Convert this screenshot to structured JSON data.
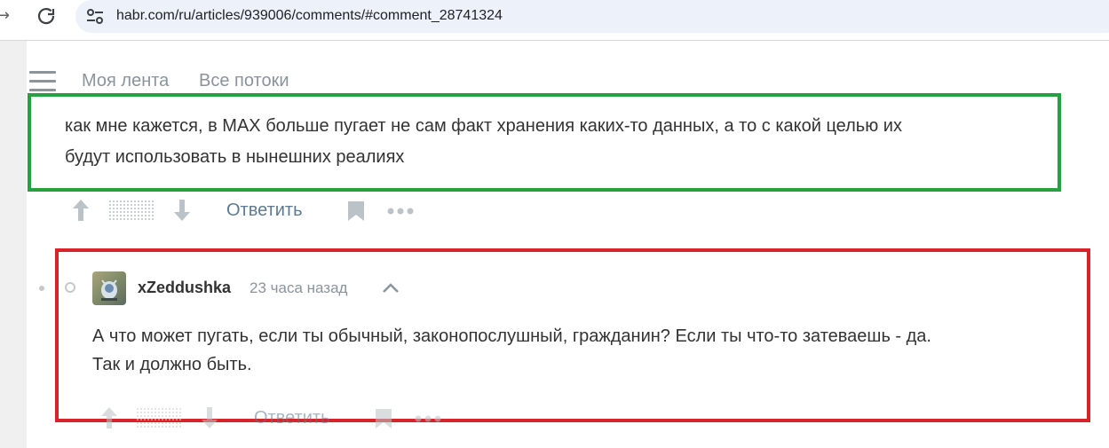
{
  "browser": {
    "url": "habr.com/ru/articles/939006/comments/#comment_28741324"
  },
  "header": {
    "nav": [
      "Моя лента",
      "Все потоки"
    ]
  },
  "comment_parent": {
    "lines": [
      "как мне кажется, в MAX больше пугает не сам факт хранения каких-то данных, а то с какой целью их",
      "будут использовать в нынешних реалиях"
    ],
    "reply_label": "Ответить"
  },
  "comment_reply": {
    "author": "xZeddushka",
    "time": "23 часа назад",
    "lines": [
      "А что может пугать, если ты обычный, законопослушный, гражданин? Если ты что-то затеваешь - да.",
      "Так и должно быть."
    ],
    "reply_label": "Ответить"
  },
  "colors": {
    "green_highlight": "#27a040",
    "red_highlight": "#d8232a",
    "link": "#5e7a91"
  },
  "icons": [
    "back-arrow-icon",
    "reload-icon",
    "site-settings-icon",
    "menu-icon",
    "upvote-icon",
    "downvote-icon",
    "bookmark-icon",
    "more-icon",
    "chevron-up-icon"
  ]
}
